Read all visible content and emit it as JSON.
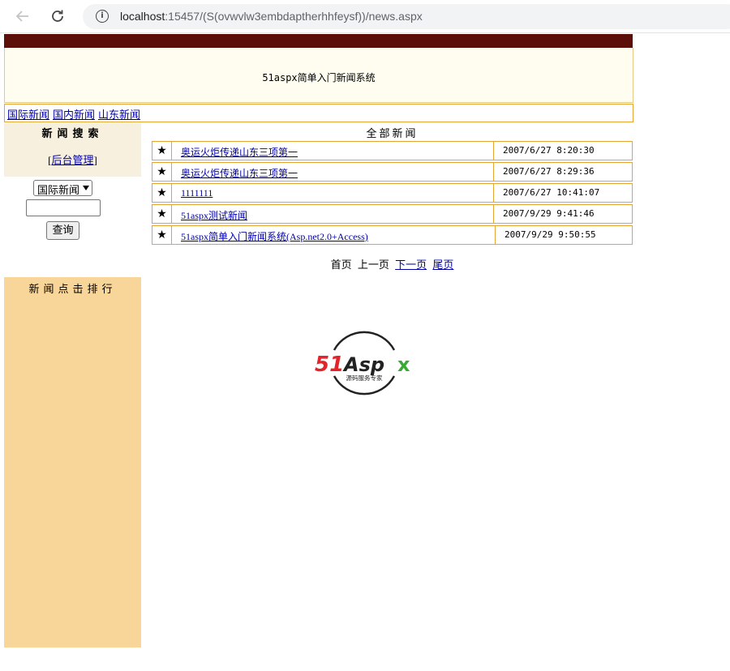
{
  "browser": {
    "url_host": "localhost",
    "url_rest": ":15457/(S(ovwvlw3embdaptherhhfeysf))/news.aspx"
  },
  "site": {
    "title": "51aspx简单入门新闻系统"
  },
  "categories": [
    "国际新闻",
    "国内新闻",
    "山东新闻"
  ],
  "sidebar": {
    "search_title": "新闻搜索",
    "admin_prefix": "[",
    "admin_link": "后台管理",
    "admin_suffix": "]",
    "category_select_value": "国际新闻",
    "query_button": "查询",
    "rank_title": "新闻点击排行"
  },
  "main": {
    "title": "全部新闻",
    "star": "★",
    "news": [
      {
        "title": "奥运火炬传递山东三项第一",
        "date": "2007/6/27 8:20:30"
      },
      {
        "title": "奥运火炬传递山东三项第一",
        "date": "2007/6/27 8:29:36"
      },
      {
        "title": "1111111",
        "date": "2007/6/27 10:41:07"
      },
      {
        "title": "51aspx测试新闻",
        "date": "2007/9/29 9:41:46"
      },
      {
        "title": "51aspx简单入门新闻系统(Asp.net2.0+Access)",
        "date": "2007/9/29 9:50:55"
      }
    ],
    "pager": {
      "first": "首页",
      "prev": "上一页",
      "next": "下一页",
      "last": "尾页"
    }
  },
  "logo": {
    "brand": "51Aspx",
    "tagline": "源码服务专家"
  },
  "colors": {
    "header_dark": "#5c0f08",
    "border": "#e5a434",
    "rank_bg": "#f8d598",
    "logo_red": "#e3242b",
    "logo_green": "#3aa935"
  }
}
